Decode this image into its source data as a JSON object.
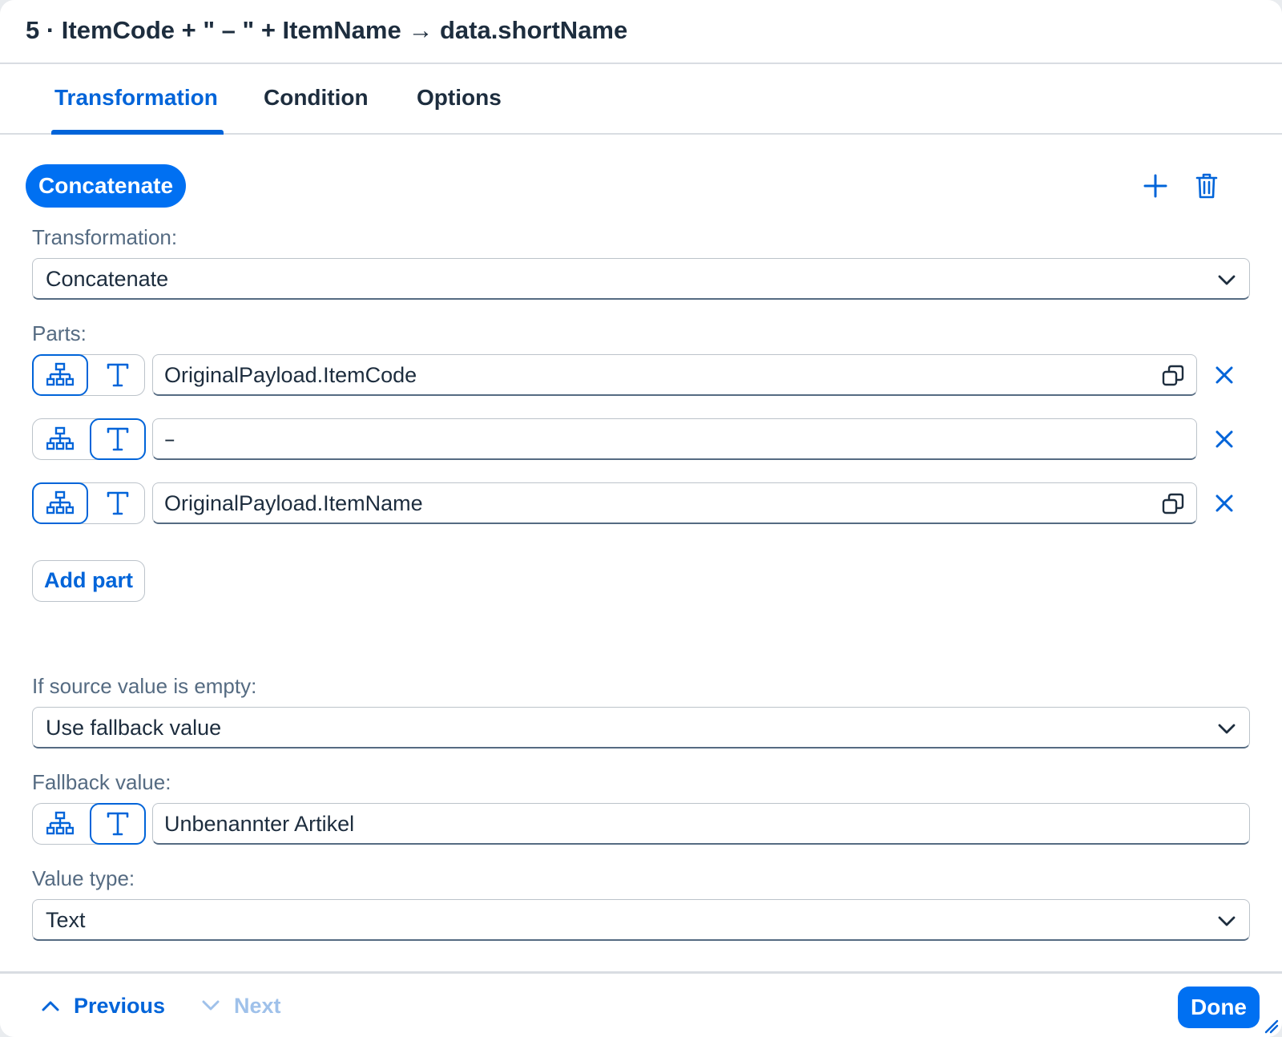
{
  "header": {
    "title": "5 · ItemCode + \" – \" + ItemName → data.shortName"
  },
  "tabs": [
    {
      "label": "Transformation",
      "active": true
    },
    {
      "label": "Condition",
      "active": false
    },
    {
      "label": "Options",
      "active": false
    }
  ],
  "transformation": {
    "chip_label": "Concatenate",
    "add_icon": "plus-icon",
    "delete_icon": "trash-icon",
    "transformation_label": "Transformation:",
    "transformation_value": "Concatenate",
    "parts_label": "Parts:",
    "parts": [
      {
        "mode": "source",
        "value": "OriginalPayload.ItemCode",
        "has_copy": true
      },
      {
        "mode": "text",
        "value": "–",
        "has_copy": false
      },
      {
        "mode": "source",
        "value": "OriginalPayload.ItemName",
        "has_copy": true
      }
    ],
    "add_part_label": "Add part",
    "empty_label": "If source value is empty:",
    "empty_value": "Use fallback value",
    "fallback_label": "Fallback value:",
    "fallback_mode": "text",
    "fallback_value": "Unbenannter Artikel",
    "value_type_label": "Value type:",
    "value_type_value": "Text"
  },
  "footer": {
    "previous_label": "Previous",
    "next_label": "Next",
    "done_label": "Done"
  },
  "colors": {
    "accent": "#0064d9",
    "primary_button": "#0070f2",
    "disabled": "#9fc1ea"
  }
}
